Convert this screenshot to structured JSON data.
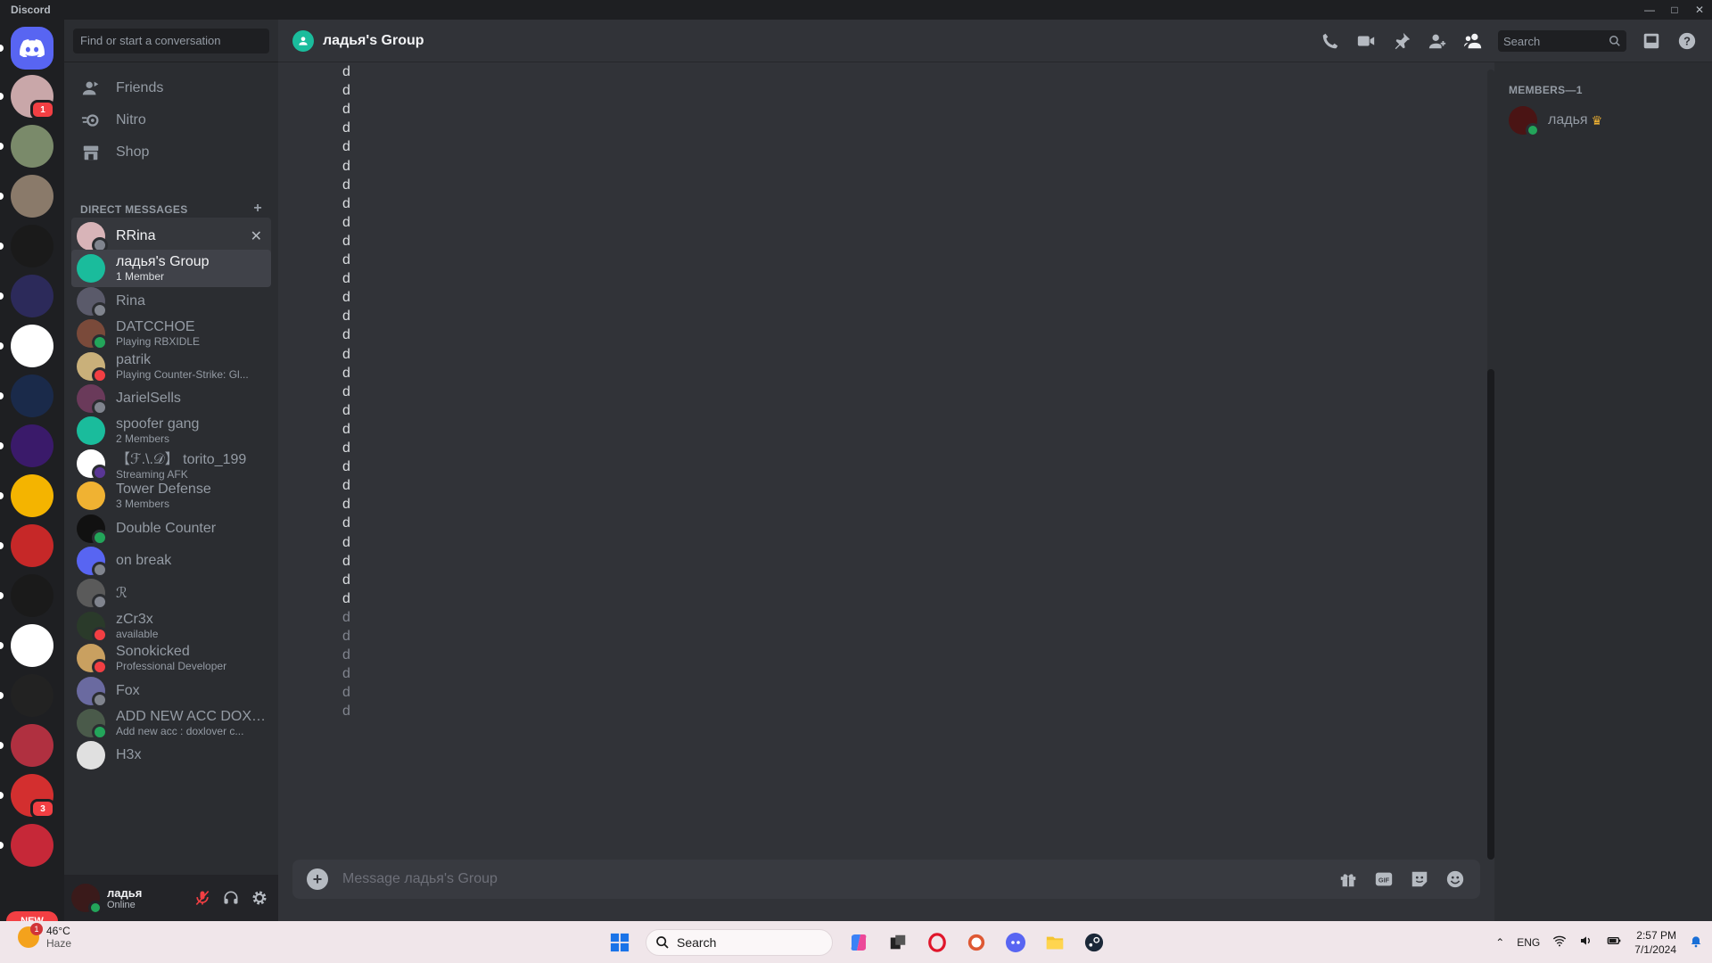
{
  "window": {
    "app_name": "Discord"
  },
  "servers": {
    "home_badge": "",
    "items": [
      {
        "name": "server-1",
        "badge": "1",
        "color": "#c9a7a9"
      },
      {
        "name": "server-2",
        "badge": "",
        "color": "#7a8a6a"
      },
      {
        "name": "server-3",
        "badge": "",
        "color": "#8a7a6a"
      },
      {
        "name": "server-4",
        "badge": "",
        "color": "#1a1a1a"
      },
      {
        "name": "server-5",
        "badge": "",
        "color": "#2c2a5a"
      },
      {
        "name": "server-6",
        "badge": "",
        "color": "#ffffff"
      },
      {
        "name": "server-7",
        "badge": "",
        "color": "#1a2a4a"
      },
      {
        "name": "server-8",
        "badge": "",
        "color": "#3a1a6a"
      },
      {
        "name": "server-9",
        "badge": "",
        "color": "#f4b400"
      },
      {
        "name": "server-10",
        "badge": "",
        "color": "#c62828"
      },
      {
        "name": "server-11",
        "badge": "",
        "color": "#1a1a1a"
      },
      {
        "name": "server-12",
        "badge": "",
        "color": "#ffffff"
      },
      {
        "name": "server-13",
        "badge": "",
        "color": "#222222"
      },
      {
        "name": "server-14",
        "badge": "",
        "color": "#b03040"
      },
      {
        "name": "server-15",
        "badge": "3",
        "color": "#d32f2f"
      },
      {
        "name": "server-16",
        "badge": "",
        "color": "#c62838"
      }
    ],
    "new_label": "NEW"
  },
  "sidebar": {
    "search_placeholder": "Find or start a conversation",
    "nav": [
      {
        "label": "Friends",
        "icon": "friends-icon"
      },
      {
        "label": "Nitro",
        "icon": "nitro-icon"
      },
      {
        "label": "Shop",
        "icon": "shop-icon"
      }
    ],
    "dm_header": "DIRECT MESSAGES",
    "dms": [
      {
        "name": "RRina",
        "sub": "",
        "color": "#d8b4b8",
        "status": "#80848e"
      },
      {
        "name": "ладья's Group",
        "sub": "1 Member",
        "color": "#1abc9c",
        "status": ""
      },
      {
        "name": "Rina",
        "sub": "",
        "color": "#5a5a6a",
        "status": "#80848e"
      },
      {
        "name": "DATCCHOE",
        "sub": "Playing RBXIDLE",
        "color": "#7a4a3a",
        "status": "#23a55a"
      },
      {
        "name": "patrik",
        "sub": "Playing Counter-Strike: Gl...",
        "color": "#c9b07a",
        "status": "#f23f43"
      },
      {
        "name": "JarielSells",
        "sub": "",
        "color": "#6a3a5a",
        "status": "#80848e"
      },
      {
        "name": "spoofer gang",
        "sub": "2 Members",
        "color": "#1abc9c",
        "status": ""
      },
      {
        "name": "【ℱ.\\.𝒟】 torito_199",
        "sub": "Streaming AFK",
        "color": "#ffffff",
        "status": "#593695"
      },
      {
        "name": "Tower Defense",
        "sub": "3 Members",
        "color": "#f0b232",
        "status": ""
      },
      {
        "name": "Double Counter",
        "sub": "",
        "color": "#111111",
        "status": "#23a55a"
      },
      {
        "name": "on break",
        "sub": "",
        "color": "#5865f2",
        "status": "#80848e"
      },
      {
        "name": "ℛ",
        "sub": "",
        "color": "#5a5a5a",
        "status": "#80848e"
      },
      {
        "name": "zCr3x",
        "sub": "available",
        "color": "#2a3a2a",
        "status": "#f23f43"
      },
      {
        "name": "Sonokicked",
        "sub": "Professional Developer",
        "color": "#c9a060",
        "status": "#f23f43"
      },
      {
        "name": "Fox",
        "sub": "",
        "color": "#6a6aa0",
        "status": "#80848e"
      },
      {
        "name": "ADD NEW ACC DOXL...",
        "sub": "Add new acc : doxlover c...",
        "color": "#4a5a4a",
        "status": "#23a55a"
      },
      {
        "name": "H3x",
        "sub": "",
        "color": "#e0e0e0",
        "status": ""
      }
    ]
  },
  "user_panel": {
    "name": "ладья",
    "status": "Online"
  },
  "channel": {
    "title": "ладья's Group",
    "search_placeholder": "Search",
    "composer_placeholder": "Message ладья's Group"
  },
  "messages": [
    {
      "text": "d",
      "dim": false
    },
    {
      "text": "d",
      "dim": false
    },
    {
      "text": "d",
      "dim": false
    },
    {
      "text": "d",
      "dim": false
    },
    {
      "text": "d",
      "dim": false
    },
    {
      "text": "d",
      "dim": false
    },
    {
      "text": "d",
      "dim": false
    },
    {
      "text": "d",
      "dim": false
    },
    {
      "text": "d",
      "dim": false
    },
    {
      "text": "d",
      "dim": false
    },
    {
      "text": "d",
      "dim": false
    },
    {
      "text": "d",
      "dim": false
    },
    {
      "text": "d",
      "dim": false
    },
    {
      "text": "d",
      "dim": false
    },
    {
      "text": "d",
      "dim": false
    },
    {
      "text": "d",
      "dim": false
    },
    {
      "text": "d",
      "dim": false
    },
    {
      "text": "d",
      "dim": false
    },
    {
      "text": "d",
      "dim": false
    },
    {
      "text": "d",
      "dim": false
    },
    {
      "text": "d",
      "dim": false
    },
    {
      "text": "d",
      "dim": false
    },
    {
      "text": "d",
      "dim": false
    },
    {
      "text": "d",
      "dim": false
    },
    {
      "text": "d",
      "dim": false
    },
    {
      "text": "d",
      "dim": false
    },
    {
      "text": "d",
      "dim": false
    },
    {
      "text": "d",
      "dim": false
    },
    {
      "text": "d",
      "dim": false
    },
    {
      "text": "d",
      "dim": true
    },
    {
      "text": "d",
      "dim": true
    },
    {
      "text": "d",
      "dim": true
    },
    {
      "text": "d",
      "dim": true
    },
    {
      "text": "d",
      "dim": true
    },
    {
      "text": "d",
      "dim": true
    }
  ],
  "members": {
    "header": "MEMBERS—1",
    "list": [
      {
        "name": "ладья",
        "owner": true
      }
    ]
  },
  "taskbar": {
    "weather_temp": "46°C",
    "weather_desc": "Haze",
    "weather_badge": "1",
    "search_label": "Search",
    "language": "ENG",
    "time": "2:57 PM",
    "date": "7/1/2024"
  }
}
